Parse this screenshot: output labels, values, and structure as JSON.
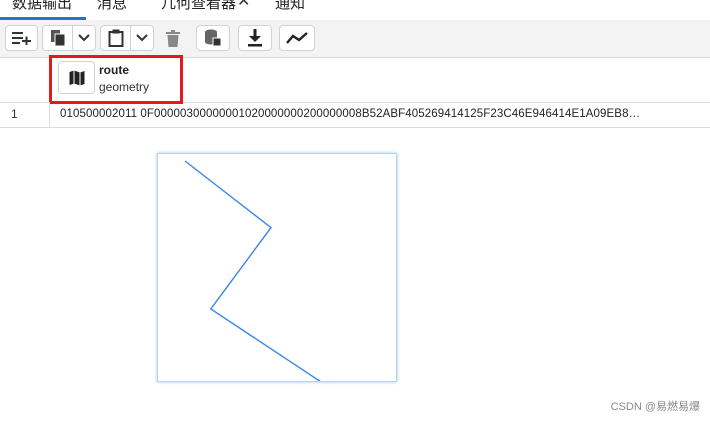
{
  "tabs": {
    "data_output": "数据输出",
    "messages": "消息",
    "geometry_viewer": "几何查看器",
    "geometry_close": "✕",
    "notifications": "通知"
  },
  "toolbar": {
    "buttons": [
      "add-row",
      "copy",
      "copy-dropdown",
      "paste",
      "paste-dropdown",
      "delete",
      "save-data",
      "download",
      "graph-visualiser"
    ]
  },
  "grid": {
    "column": {
      "name": "route",
      "type": "geometry"
    },
    "rows": [
      {
        "num": "1",
        "value": "010500002011 0F00000300000001020000000200000008B52ABF405269414125F23C46E946414E1A09EB8…"
      }
    ]
  },
  "geometry_viewer": {
    "line_color": "#3a86e8",
    "polyline": [
      [
        0,
        0
      ],
      [
        1,
        0.45
      ],
      [
        0.3,
        1
      ],
      [
        1.6,
        1.5
      ]
    ]
  },
  "watermark": "CSDN @易燃易爆",
  "colors": {
    "highlight": "#e2191f",
    "active_tab": "#2f6fc4"
  }
}
